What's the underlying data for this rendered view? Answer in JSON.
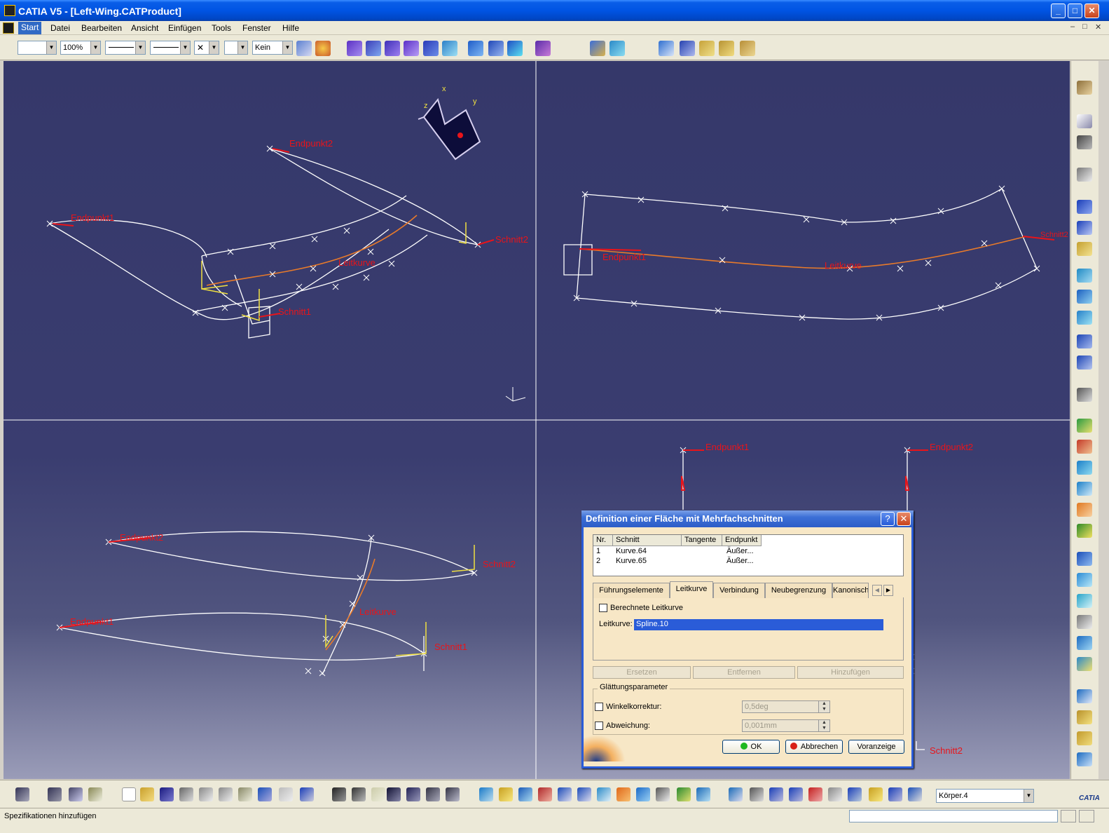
{
  "window": {
    "title": "CATIA V5 - [Left-Wing.CATProduct]",
    "minimize": "_",
    "maximize": "□",
    "close": "✕"
  },
  "menu": {
    "items": [
      "Start",
      "Datei",
      "Bearbeiten",
      "Ansicht",
      "Einfügen",
      "Tools",
      "Fenster",
      "Hilfe"
    ],
    "mdi_controls": [
      "–",
      "□",
      "✕"
    ]
  },
  "toolbar": {
    "color_value": "",
    "zoom_value": "100%",
    "layer_value": "Kein"
  },
  "viewport": {
    "quadrant_tl": {
      "labels": {
        "endpunkt2": "Endpunkt2",
        "endpunkt1": "Endpunkt1",
        "schnitt2": "Schnitt2",
        "leitkurve": "Leitkurve",
        "schnitt1": "Schnitt1"
      },
      "axis": {
        "x": "x",
        "y": "y",
        "z": "z"
      }
    },
    "quadrant_tr": {
      "labels": {
        "endpunkt1": "Endpunkt1",
        "leitkurve": "Leitkurve",
        "right": "Schnitt2"
      }
    },
    "quadrant_bl": {
      "labels": {
        "endpunkt2": "Endpunkt2",
        "schnitt2": "Schnitt2",
        "endpunkt1": "Endpunkt1",
        "leitkurve": "Leitkurve",
        "schnitt1": "Schnitt1"
      }
    },
    "quadrant_br": {
      "labels": {
        "endpunkt1": "Endpunkt1",
        "endpunkt2": "Endpunkt2",
        "schnitt2": "Schnitt2"
      }
    }
  },
  "dialog": {
    "title": "Definition einer Fläche mit Mehrfachschnitten",
    "help": "?",
    "close": "✕",
    "table": {
      "headers": [
        "Nr.",
        "Schnitt",
        "Tangente",
        "Endpunkt"
      ],
      "rows": [
        {
          "nr": "1",
          "schnitt": "Kurve.64",
          "tangente": "",
          "endpunkt": "Äußer..."
        },
        {
          "nr": "2",
          "schnitt": "Kurve.65",
          "tangente": "",
          "endpunkt": "Äußer..."
        }
      ]
    },
    "tabs": [
      "Führungselemente",
      "Leitkurve",
      "Verbindung",
      "Neubegrenzung",
      "Kanonisch"
    ],
    "active_tab": "Leitkurve",
    "berechnete_label": "Berechnete Leitkurve",
    "leitkurve_label": "Leitkurve:",
    "leitkurve_value": "Spline.10",
    "buttons_disabled": [
      "Ersetzen",
      "Entfernen",
      "Hinzufügen"
    ],
    "group_label": "Glättungsparameter",
    "winkel_label": "Winkelkorrektur:",
    "winkel_value": "0,5deg",
    "abweichung_label": "Abweichung:",
    "abweichung_value": "0,001mm",
    "ok_label": "OK",
    "cancel_label": "Abbrechen",
    "preview_label": "Voranzeige"
  },
  "bottom": {
    "body_combo": "Körper.4"
  },
  "status": {
    "text": "Spezifikationen hinzufügen"
  },
  "brand": {
    "logo_text": "CATIA"
  }
}
